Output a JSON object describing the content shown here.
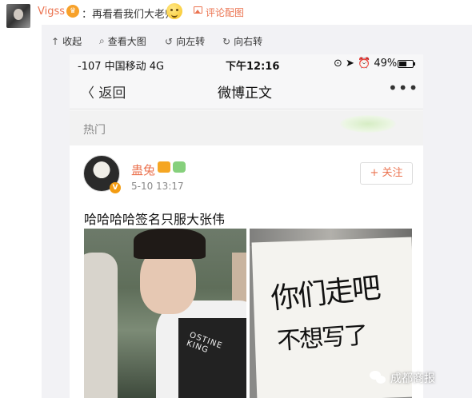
{
  "comment": {
    "username": "Vigss",
    "vip_badge": "♛",
    "text": "：再看看我们大老师",
    "emoji_icon": "smile-emoji-icon",
    "comment_pic_label": "评论配图"
  },
  "toolbar": {
    "collapse": "收起",
    "view_large": "查看大图",
    "rotate_left": "向左转",
    "rotate_right": "向右转"
  },
  "phone": {
    "status": {
      "carrier": "-107 中国移动  4G",
      "time": "下午12:16",
      "right": "⊙ ➤ ⏰ 49%"
    },
    "nav": {
      "back": "〈 返回",
      "title": "微博正文",
      "more": "•••"
    },
    "section_label": "热门",
    "post": {
      "author": "蛊兔",
      "verified_badge": "V",
      "time": "5-10 13:17",
      "follow_label": "+ 关注",
      "text": "哈哈哈哈签名只服大张伟",
      "left_shirt_text": "OSTINE KING",
      "sign_line1": "你们走吧",
      "sign_line2": "不想写了"
    }
  },
  "watermark": "成都商报",
  "colors": {
    "accent": "#eb7350",
    "panel_bg": "#f2f2f5"
  }
}
